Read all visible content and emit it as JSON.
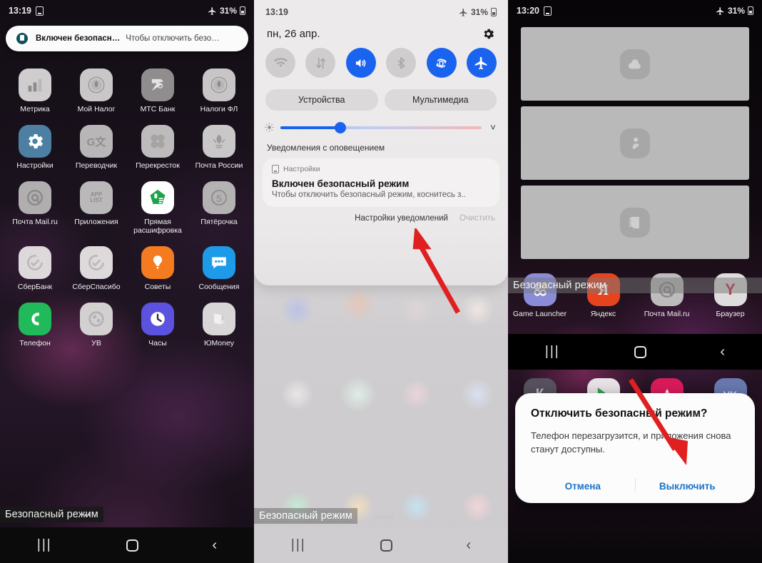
{
  "panel1": {
    "status": {
      "time": "13:19",
      "notification_icon": "note-icon",
      "airplane_icon": "airplane-icon",
      "battery": "31%"
    },
    "heads_up": {
      "icon": "settings-safe-mode-icon",
      "title": "Включен безопасн…",
      "body": "Чтобы отключить безо…"
    },
    "apps": [
      {
        "label": "Метрика",
        "icon": "metrica-icon",
        "bg": "#cfcdcd"
      },
      {
        "label": "Мой Налог",
        "icon": "nalog-coin-icon",
        "bg": "#c9c7c7"
      },
      {
        "label": "МТС Банк",
        "icon": "mts-bank-icon",
        "bg": "#8f8d8d"
      },
      {
        "label": "Налоги ФЛ",
        "icon": "nalogi-fl-icon",
        "bg": "#c7c5c5"
      },
      {
        "label": "Настройки",
        "icon": "gear-icon",
        "bg": "#4d7fa3"
      },
      {
        "label": "Переводчик",
        "icon": "translate-icon",
        "bg": "#b8b6b6"
      },
      {
        "label": "Перекресток",
        "icon": "perekrestok-icon",
        "bg": "#bdbbbb"
      },
      {
        "label": "Почта России",
        "icon": "pochta-rossii-icon",
        "bg": "#c9c7c7"
      },
      {
        "label": "Почта Mail.ru",
        "icon": "mail-at-icon",
        "bg": "#b0aeae"
      },
      {
        "label": "Приложения",
        "icon": "app-list-icon",
        "bg": "#bab8b8"
      },
      {
        "label": "Прямая расшифровка",
        "icon": "live-transcribe-icon",
        "bg": "#ffffff"
      },
      {
        "label": "Пятёрочка",
        "icon": "pyaterochka-icon",
        "bg": "#b4b2b2"
      },
      {
        "label": "СберБанк",
        "icon": "sberbank-icon",
        "bg": "#ddd9da"
      },
      {
        "label": "СберСпасибо",
        "icon": "sberspasibo-icon",
        "bg": "#dedadb"
      },
      {
        "label": "Советы",
        "icon": "tips-bulb-icon",
        "bg": "#f47b20"
      },
      {
        "label": "Сообщения",
        "icon": "messages-icon",
        "bg": "#1e9be8"
      },
      {
        "label": "Телефон",
        "icon": "phone-icon",
        "bg": "#21ba5a"
      },
      {
        "label": "УВ",
        "icon": "uv-icon",
        "bg": "#d2d0d0"
      },
      {
        "label": "Часы",
        "icon": "clock-icon",
        "bg": "#5b52e0"
      },
      {
        "label": "ЮMoney",
        "icon": "yumoney-icon",
        "bg": "#d8d6d6"
      }
    ],
    "safe_mode_badge": "Безопасный режим",
    "page_dots": "• •",
    "navbar": {
      "recent": "recents-icon",
      "home": "home-icon",
      "back": "back-icon"
    }
  },
  "panel2": {
    "status": {
      "time": "13:19",
      "airplane_icon": "airplane-icon",
      "battery": "31%"
    },
    "date": "пн, 26 апр.",
    "settings_icon": "gear-icon",
    "toggles": [
      {
        "name": "wifi",
        "icon": "wifi-icon",
        "state": "off"
      },
      {
        "name": "mobile-data",
        "icon": "data-arrows-icon",
        "state": "off"
      },
      {
        "name": "sound",
        "icon": "volume-icon",
        "state": "on"
      },
      {
        "name": "bluetooth",
        "icon": "bluetooth-icon",
        "state": "off"
      },
      {
        "name": "auto-rotate",
        "icon": "auto-rotate-icon",
        "state": "on"
      },
      {
        "name": "airplane-mode",
        "icon": "airplane-icon",
        "state": "on"
      }
    ],
    "chips": [
      "Устройства",
      "Мультимедиа"
    ],
    "brightness": {
      "icon": "brightness-icon",
      "value_percent": 29,
      "expand_icon": "chevron-down-icon"
    },
    "section_title": "Уведомления с оповещением",
    "notification": {
      "app_icon": "settings-icon",
      "app": "Настройки",
      "title": "Включен безопасный режим",
      "body": "Чтобы отключить безопасный режим, коснитесь з.."
    },
    "actions": {
      "settings": "Настройки уведомлений",
      "clear": "Очистить"
    },
    "safe_mode_badge": "Безопасный режим",
    "ghost_text": "режим",
    "navbar": {
      "recent": "recents-icon",
      "home": "home-icon",
      "back": "back-icon"
    }
  },
  "panel3": {
    "status": {
      "time": "13:20",
      "notification_icon": "note-icon",
      "airplane_icon": "airplane-icon",
      "battery": "31%"
    },
    "recent_cards": [
      {
        "icon": "weather-icon"
      },
      {
        "icon": "kids-mode-icon"
      },
      {
        "icon": "notes-icon"
      }
    ],
    "apps": [
      {
        "label": "Game Launcher",
        "icon": "game-launcher-icon",
        "bg": "#8b8cd8"
      },
      {
        "label": "Яндекс",
        "icon": "yandex-icon",
        "bg": "#e8431f"
      },
      {
        "label": "Почта Mail.ru",
        "icon": "mail-at-icon",
        "bg": "#bdbbbb"
      },
      {
        "label": "Браузер",
        "icon": "yandex-browser-icon",
        "bg": "#dedcdc"
      }
    ],
    "apps_row2": [
      {
        "label": "",
        "icon": "kinopoisk-icon",
        "bg": "#5a5560"
      },
      {
        "label": "",
        "icon": "play-store-icon",
        "bg": "#f0eef0"
      },
      {
        "label": "",
        "icon": "aliexpress-icon",
        "bg": "#e31c5f"
      },
      {
        "label": "",
        "icon": "vk-icon",
        "bg": "#6d7fb8"
      }
    ],
    "dialog": {
      "title": "Отключить безопасный режим?",
      "message": "Телефон перезагрузится, и приложения снова станут доступны.",
      "cancel": "Отмена",
      "confirm": "Выключить"
    },
    "safe_mode_badge": "Безопасный режим",
    "navbar": {
      "recent": "recents-icon",
      "home": "home-icon",
      "back": "back-icon"
    }
  },
  "annotations": {
    "arrow_color": "#e02020",
    "arrow_count": 2
  },
  "colors": {
    "accent_blue": "#1a63ef",
    "dialog_link": "#1a73c8",
    "arrow_red": "#e02020"
  }
}
